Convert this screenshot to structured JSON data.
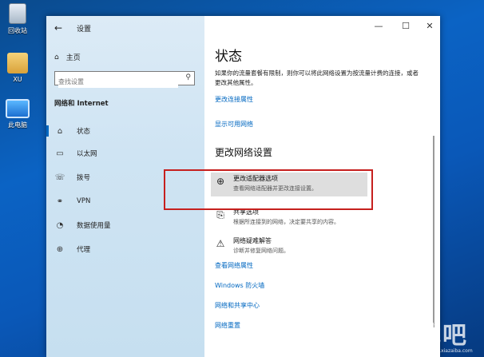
{
  "desktop": {
    "icons": [
      {
        "label": "回收站",
        "icon": "recycle-bin-icon"
      },
      {
        "label": "XU",
        "icon": "user-folder-icon"
      },
      {
        "label": "此电脑",
        "icon": "this-pc-icon"
      }
    ]
  },
  "window": {
    "title": "设置",
    "controls": {
      "minimize": "—",
      "maximize": "☐",
      "close": "✕"
    }
  },
  "sidebar": {
    "home_label": "主页",
    "search_placeholder": "查找设置",
    "section_title": "网络和 Internet",
    "items": [
      {
        "label": "状态",
        "icon": "status-icon",
        "active": true
      },
      {
        "label": "以太网",
        "icon": "ethernet-icon",
        "active": false
      },
      {
        "label": "拨号",
        "icon": "dialup-icon",
        "active": false
      },
      {
        "label": "VPN",
        "icon": "vpn-icon",
        "active": false
      },
      {
        "label": "数据使用量",
        "icon": "data-usage-icon",
        "active": false
      },
      {
        "label": "代理",
        "icon": "proxy-icon",
        "active": false
      }
    ]
  },
  "main": {
    "title": "状态",
    "description": "如果你的流量套餐有限制，则你可以将此网络设置为按流量计费的连接，或者更改其他属性。",
    "link_change_props": "更改连接属性",
    "link_show_networks": "显示可用网络",
    "section_title": "更改网络设置",
    "options": [
      {
        "title": "更改适配器选项",
        "subtitle": "查看网络适配器并更改连接设置。",
        "icon": "adapter-icon"
      },
      {
        "title": "共享选项",
        "subtitle": "根据所连接到的网络，决定要共享的内容。",
        "icon": "sharing-icon"
      },
      {
        "title": "网络疑难解答",
        "subtitle": "诊断并修复网络问题。",
        "icon": "warning-icon"
      }
    ],
    "links": [
      "查看网络属性",
      "Windows 防火墙",
      "网络和共享中心",
      "网络重置"
    ]
  },
  "colors": {
    "accent": "#0067c0",
    "highlight_border": "#c6201e"
  },
  "watermark": {
    "text": "下载吧",
    "url": "www.xiazaiba.com"
  }
}
